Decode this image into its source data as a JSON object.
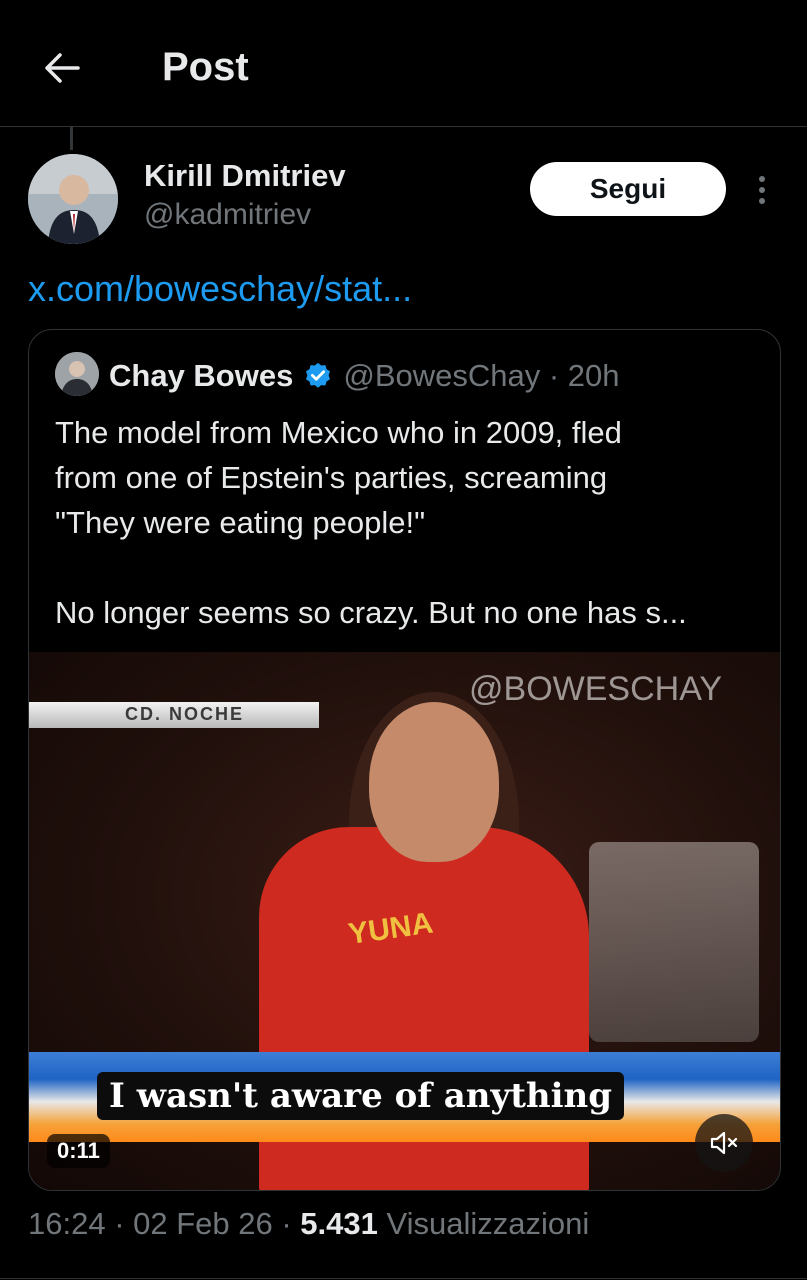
{
  "header": {
    "title": "Post"
  },
  "post": {
    "author_name": "Kirill Dmitriev",
    "author_handle": "@kadmitriev",
    "follow_label": "Segui",
    "link_text": "x.com/boweschay/stat..."
  },
  "quote": {
    "name": "Chay Bowes",
    "handle_time": "@BowesChay · 20h",
    "text_lines": [
      "The model from Mexico who in 2009, fled",
      "from one of  Epstein's parties, screaming",
      "\"They were eating people!\"",
      "No longer seems so crazy. But no one has s..."
    ],
    "video": {
      "watermark": "@BOWESCHAY",
      "chyron": "CD. NOCHE",
      "shirt_text": "YUNA",
      "caption": "I wasn't aware of anything",
      "duration": "0:11"
    }
  },
  "meta": {
    "time": "16:24 · 02 Feb 26 · ",
    "views_count": "5.431",
    "views_label": " Visualizzazioni"
  },
  "colors": {
    "accent": "#1d9bf0",
    "background": "#000000",
    "muted": "#71767b"
  },
  "icons": [
    "back-arrow-icon",
    "more-options-icon",
    "verified-badge-icon",
    "mute-icon"
  ]
}
